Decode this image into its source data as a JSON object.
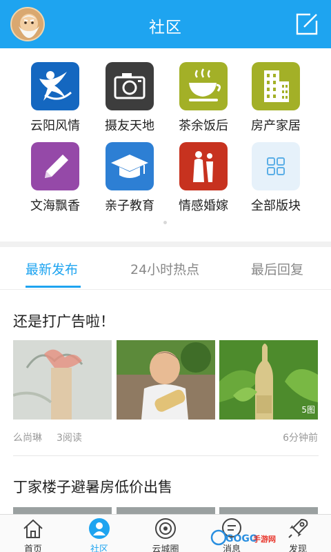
{
  "header": {
    "title": "社区",
    "avatar_icon": "user-avatar",
    "compose_icon": "edit-icon"
  },
  "categories": [
    {
      "label": "云阳风情",
      "icon": "dancer-icon",
      "color": "#1467c0"
    },
    {
      "label": "摄友天地",
      "icon": "camera-icon",
      "color": "#3d3d3d"
    },
    {
      "label": "茶余饭后",
      "icon": "tea-cup-icon",
      "color": "#a3b027"
    },
    {
      "label": "房产家居",
      "icon": "building-icon",
      "color": "#a3b027"
    },
    {
      "label": "文海飘香",
      "icon": "pencil-icon",
      "color": "#9549a8"
    },
    {
      "label": "亲子教育",
      "icon": "graduation-cap-icon",
      "color": "#2d7fd4"
    },
    {
      "label": "情感婚嫁",
      "icon": "couple-icon",
      "color": "#c7321f"
    },
    {
      "label": "全部版块",
      "icon": "grid-icon",
      "color": "#e6f1fa"
    }
  ],
  "tabs": [
    {
      "label": "最新发布",
      "active": true
    },
    {
      "label": "24小时热点",
      "active": false
    },
    {
      "label": "最后回复",
      "active": false
    }
  ],
  "posts": [
    {
      "title": "还是打广告啦！",
      "author": "么尚琳",
      "reads": "3阅读",
      "time": "6分钟前",
      "image_count": "5图"
    },
    {
      "title": "丁家楼子避暑房低价出售"
    }
  ],
  "bottom_nav": [
    {
      "label": "首页",
      "icon": "home-icon",
      "active": false
    },
    {
      "label": "社区",
      "icon": "community-icon",
      "active": true
    },
    {
      "label": "云城圈",
      "icon": "circle-icon",
      "active": false
    },
    {
      "label": "消息",
      "icon": "message-icon",
      "active": false
    },
    {
      "label": "发现",
      "icon": "rocket-icon",
      "active": false
    }
  ],
  "watermark": "GOGO手游网",
  "colors": {
    "accent": "#1ea4f0",
    "header_bg": "#1ea4f0",
    "muted_text": "#999999"
  }
}
